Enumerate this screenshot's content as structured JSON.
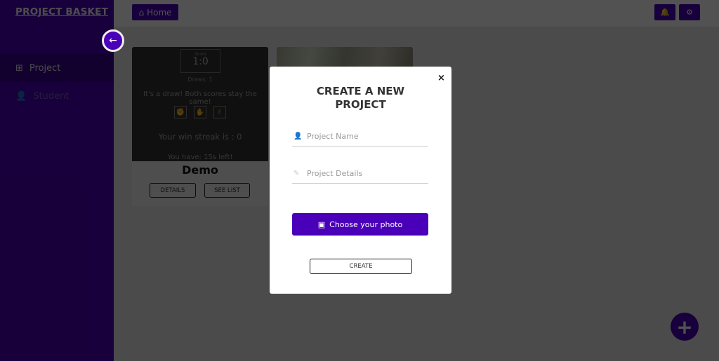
{
  "app": {
    "brand": "PROJECT BASKET"
  },
  "sidebar": {
    "collapse_icon": "arrow-left-icon",
    "items": [
      {
        "label": "Project",
        "icon": "grid-icon",
        "active": true
      },
      {
        "label": "Student",
        "icon": "student-icon",
        "active": false
      }
    ]
  },
  "topbar": {
    "home_label": "Home",
    "home_icon": "home-icon",
    "notifications_icon": "bell-icon",
    "settings_icon": "gear-icon"
  },
  "cards": [
    {
      "title": "Demo",
      "preview": {
        "score_label": "Score",
        "score_value": "1:0",
        "draws": "Draws: 1",
        "message": "It's a draw! Both scores stay the same!",
        "choices": [
          "rock",
          "paper",
          "scissors"
        ],
        "streak": "Your win streak is : 0",
        "timer": "You have: 15s left!"
      },
      "buttons": {
        "details": "DETAILS",
        "see_list": "SEE LIST"
      }
    },
    {
      "title": "",
      "preview_type": "image"
    }
  ],
  "fab": {
    "label": "+",
    "icon": "plus-icon"
  },
  "modal": {
    "close_label": "×",
    "title_line1": "CREATE A NEW",
    "title_line2": "PROJECT",
    "project_name": {
      "value": "",
      "placeholder": "Project Name"
    },
    "project_details": {
      "value": "",
      "placeholder": "Project Details"
    },
    "photo_button": "Choose your photo",
    "create_button": "CREATE"
  },
  "colors": {
    "primary": "#4a00b8",
    "sidebar_active": "#3a0094"
  }
}
